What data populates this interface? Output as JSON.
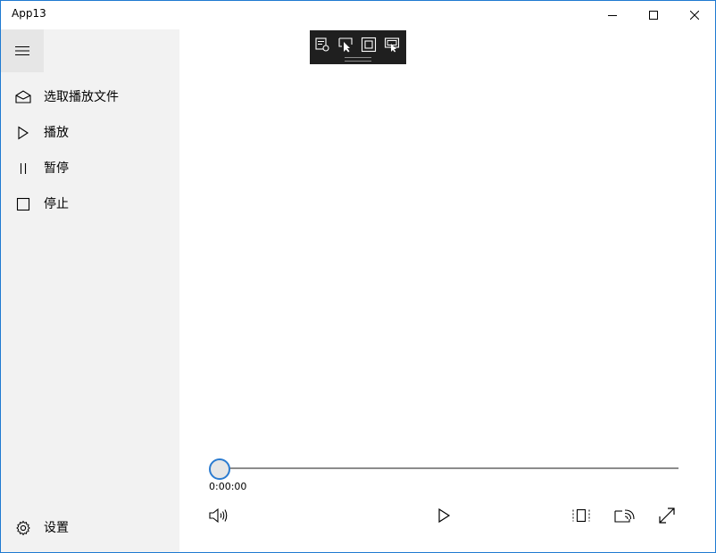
{
  "window": {
    "title": "App13",
    "controls": {
      "minimize_icon": "minimize-icon",
      "maximize_icon": "maximize-icon",
      "close_icon": "close-icon"
    }
  },
  "sidebar": {
    "menu_icon": "hamburger-icon",
    "items": [
      {
        "label": "选取播放文件",
        "icon": "open-file-icon"
      },
      {
        "label": "播放",
        "icon": "play-icon"
      },
      {
        "label": "暂停",
        "icon": "pause-icon"
      },
      {
        "label": "停止",
        "icon": "stop-icon"
      }
    ],
    "settings": {
      "label": "设置",
      "icon": "gear-icon"
    }
  },
  "debug_toolbar": {
    "tools": [
      "live-visual-tree-icon",
      "select-element-icon",
      "display-layout-adorners-icon",
      "track-focus-icon"
    ]
  },
  "player": {
    "position": 0,
    "time": "0:00:00",
    "controls": [
      "volume-icon",
      "play-icon",
      "aspect-ratio-icon",
      "cast-to-device-icon",
      "fullscreen-icon"
    ]
  },
  "colors": {
    "accent": "#2b7bd0",
    "sidebar_bg": "#f2f2f2",
    "toolbar_bg": "#1f1f1f",
    "window_border": "#1f7ad1"
  }
}
